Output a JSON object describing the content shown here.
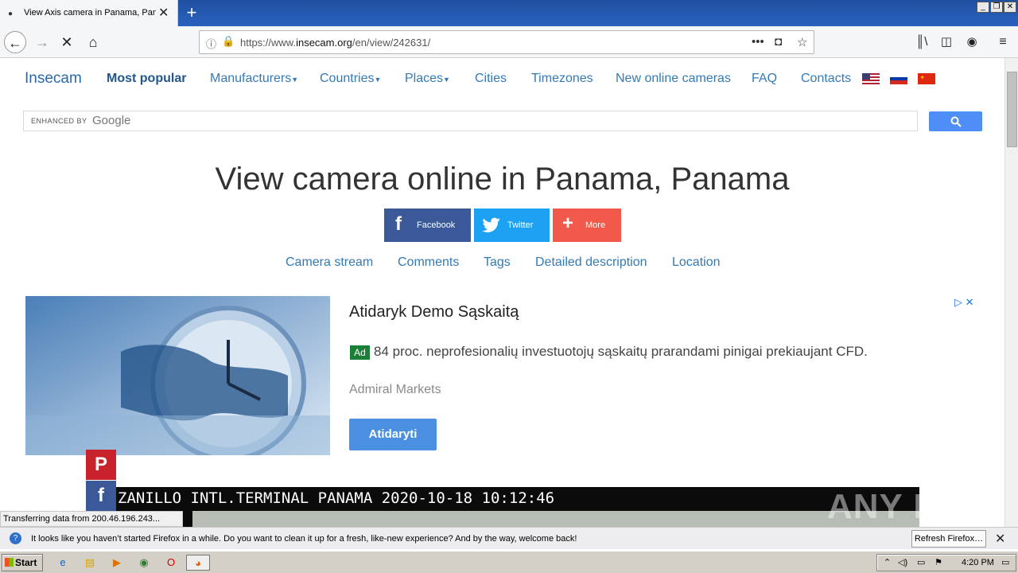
{
  "browser": {
    "tab_title": "View Axis camera in Panama, Pana",
    "url_prefix": "https://www.",
    "url_domain": "insecam.org",
    "url_path": "/en/view/242631/",
    "status_text": "Transferring data from 200.46.196.243..."
  },
  "site": {
    "brand": "Insecam",
    "nav": {
      "most_popular": "Most popular",
      "manufacturers": "Manufacturers",
      "countries": "Countries",
      "places": "Places",
      "cities": "Cities",
      "timezones": "Timezones",
      "new_online": "New online cameras",
      "faq": "FAQ",
      "contacts": "Contacts"
    },
    "search_label": "ENHANCED BY",
    "search_google": "Google"
  },
  "page": {
    "heading": "View camera online in Panama, Panama",
    "share": {
      "facebook": "Facebook",
      "twitter": "Twitter",
      "more": "More"
    },
    "subnav": {
      "stream": "Camera stream",
      "comments": "Comments",
      "tags": "Tags",
      "description": "Detailed description",
      "location": "Location"
    }
  },
  "ad": {
    "title": "Atidaryk Demo Sąskaitą",
    "badge": "Ad",
    "description": "84 proc. neprofesionalių investuotojų sąskaitų prarandami pinigai prekiaujant CFD.",
    "advertiser": "Admiral Markets",
    "button": "Atidaryti"
  },
  "camera": {
    "overlay_text": "ZANILLO INTL.TERMINAL PANAMA 2020-10-18 10:12:46"
  },
  "watermark": "ANY RUN",
  "notification": {
    "message": "It looks like you haven’t started Firefox in a while. Do you want to clean it up for a fresh, like-new experience? And by the way, welcome back!",
    "button": "Refresh Firefox…"
  },
  "taskbar": {
    "start": "Start",
    "clock": "4:20 PM"
  },
  "colors": {
    "link": "#337ab7",
    "facebook": "#3b5998",
    "twitter": "#1da1f2",
    "more": "#f15a4a",
    "pinterest": "#c8232c"
  }
}
